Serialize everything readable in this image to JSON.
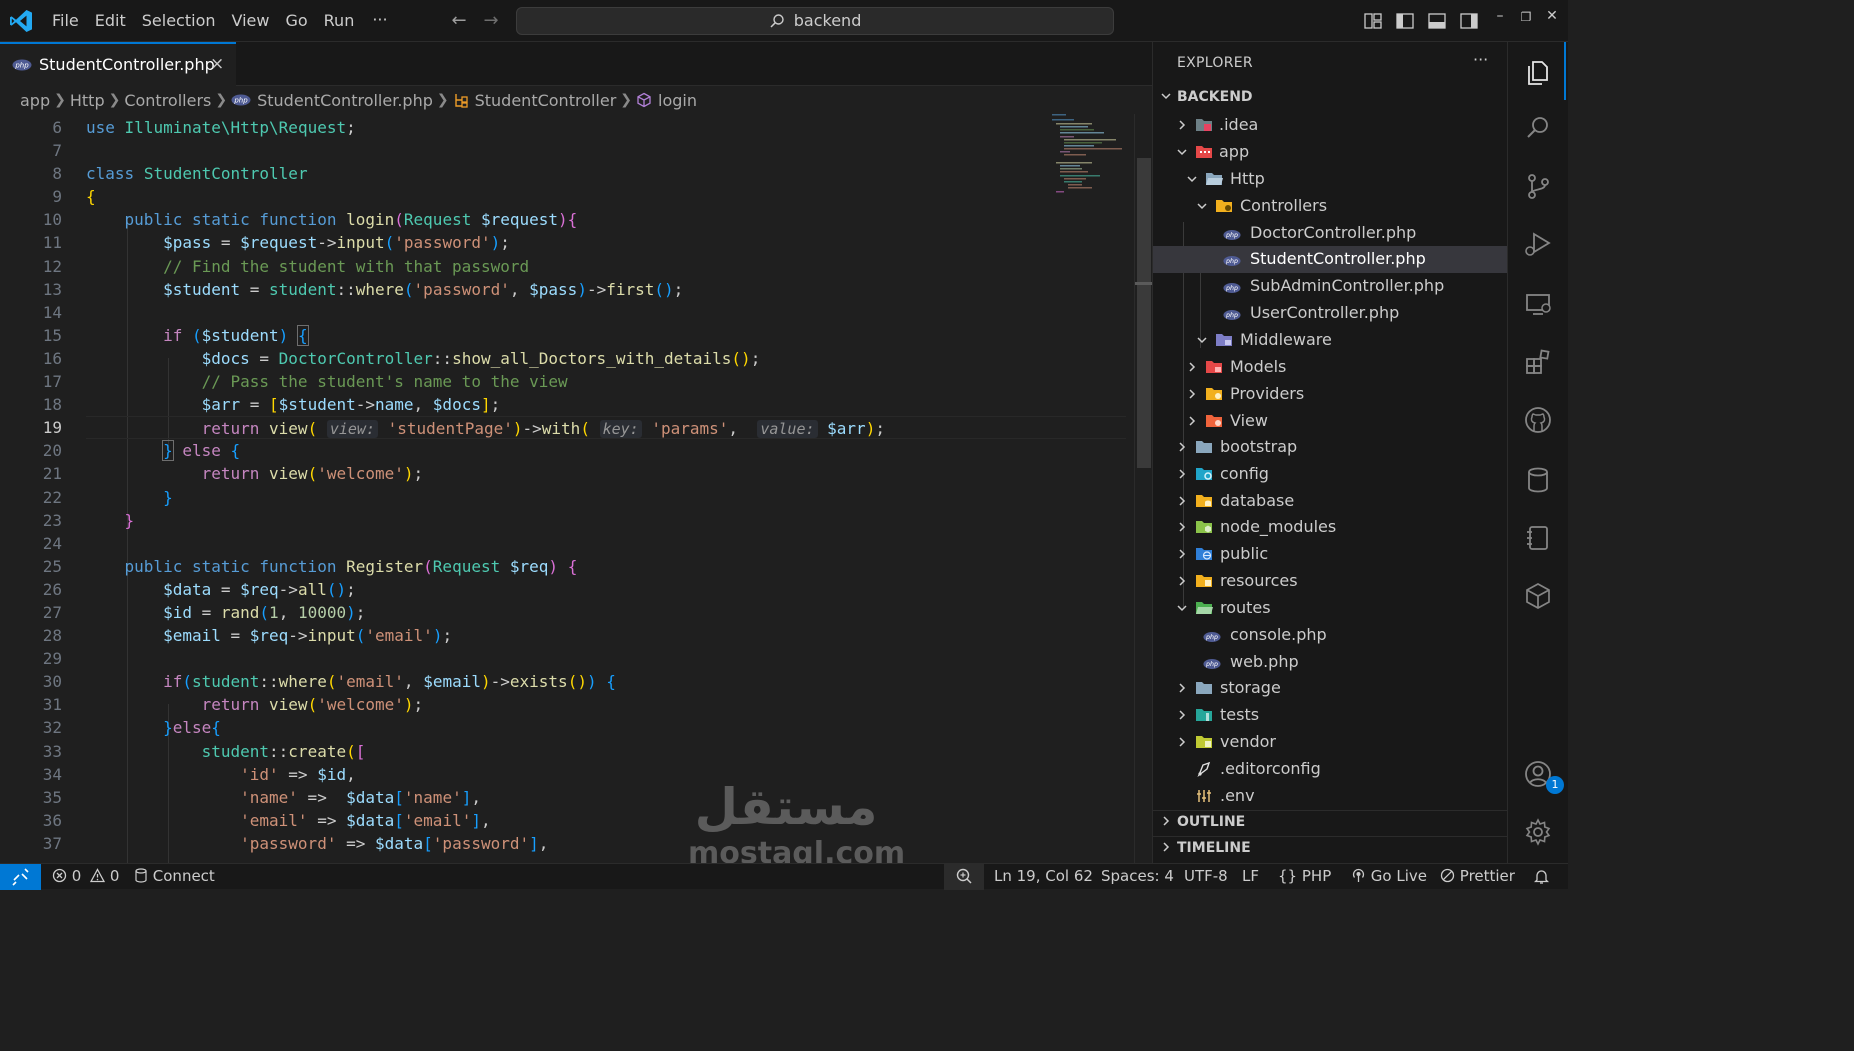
{
  "titlebar": {
    "menu": [
      "File",
      "Edit",
      "Selection",
      "View",
      "Go",
      "Run"
    ],
    "more": "···",
    "search": "backend"
  },
  "tab": {
    "label": "StudentController.php",
    "close": "×"
  },
  "breadcrumb": [
    "app",
    "Http",
    "Controllers",
    "StudentController.php",
    "StudentController",
    "login"
  ],
  "code": {
    "line_numbers": [
      "6",
      "7",
      "8",
      "9",
      "10",
      "11",
      "12",
      "13",
      "14",
      "15",
      "16",
      "17",
      "18",
      "19",
      "20",
      "21",
      "22",
      "23",
      "24",
      "25",
      "26",
      "27",
      "28",
      "29",
      "30",
      "31",
      "32",
      "33",
      "34",
      "35",
      "36",
      "37"
    ],
    "active_line": "19",
    "hints": {
      "view": "view:",
      "key": "key:",
      "value": "value:"
    }
  },
  "explorer": {
    "title": "EXPLORER",
    "more": "···",
    "root": "BACKEND",
    "items": [
      ".idea",
      "app",
      "Http",
      "Controllers",
      "DoctorController.php",
      "StudentController.php",
      "SubAdminController.php",
      "UserController.php",
      "Middleware",
      "Models",
      "Providers",
      "View",
      "bootstrap",
      "config",
      "database",
      "node_modules",
      "public",
      "resources",
      "routes",
      "console.php",
      "web.php",
      "storage",
      "tests",
      "vendor",
      ".editorconfig",
      ".env"
    ],
    "outline": "OUTLINE",
    "timeline": "TIMELINE"
  },
  "activity": {
    "accounts_badge": "1"
  },
  "status": {
    "errors": "0",
    "warnings": "0",
    "connect": "Connect",
    "position": "Ln 19, Col 62",
    "spaces": "Spaces: 4",
    "encoding": "UTF-8",
    "eol": "LF",
    "language": "PHP",
    "golive": "Go Live",
    "prettier": "Prettier"
  },
  "watermark": {
    "arabic": "مستقل",
    "latin": "mostaql.com"
  },
  "colors": {
    "accent": "#0078d4",
    "background": "#1f1f1f",
    "sidebar": "#181818"
  }
}
